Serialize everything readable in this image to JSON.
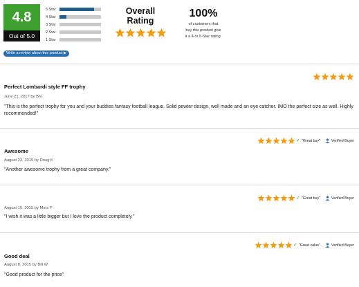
{
  "summary": {
    "score": "4.8",
    "out_of": "Out of 5.0",
    "distribution": [
      {
        "label": "5 Star",
        "fraction": 0.84
      },
      {
        "label": "4 Star",
        "fraction": 0.16
      },
      {
        "label": "3 Star",
        "fraction": 0
      },
      {
        "label": "2 Star",
        "fraction": 0
      },
      {
        "label": "1 Star",
        "fraction": 0
      }
    ],
    "overall_title_1": "Overall",
    "overall_title_2": "Rating",
    "overall_stars": 5,
    "percent": "100%",
    "percent_text_1": "of customers that",
    "percent_text_2": "buy this product give",
    "percent_text_3": "it a 4 or 5-Star rating.",
    "write_review_label": "Write a review about this product ▶"
  },
  "colors": {
    "score_green": "#3ea02e",
    "bar_blue": "#1f5e8c",
    "star_orange": "#f39c12",
    "button_blue": "#2a6fb0"
  },
  "reviews": [
    {
      "title": "Perfect Lombardi style FF trophy",
      "meta": "June 21, 2017 by BN",
      "body": "\"This is the perfect trophy for you and your buddies fantasy football league. Solid pewter design, well made and an eye catcher. IMO the perfect size as well. Highly recommended!\"",
      "rating": 5,
      "tag": "",
      "verified": ""
    },
    {
      "title": "Awesome",
      "meta": "August 23, 2015 by Doug K",
      "body": "\"Another awesome trophy from a great company.\"",
      "rating": 5,
      "tag": "\"Great buy\"",
      "verified": "Verified Buyer"
    },
    {
      "title": "",
      "meta": "August 15, 2015 by Marc F",
      "body": "\"I wish it was a little bigger but I love the product completely.\"",
      "rating": 5,
      "tag": "\"Great buy\"",
      "verified": "Verified Buyer"
    },
    {
      "title": "Good deal",
      "meta": "August 8, 2015 by Bill W",
      "body": "\"Good product for the price\"",
      "rating": 5,
      "tag": "\"Great value\"",
      "verified": "Verified Buyer"
    }
  ]
}
